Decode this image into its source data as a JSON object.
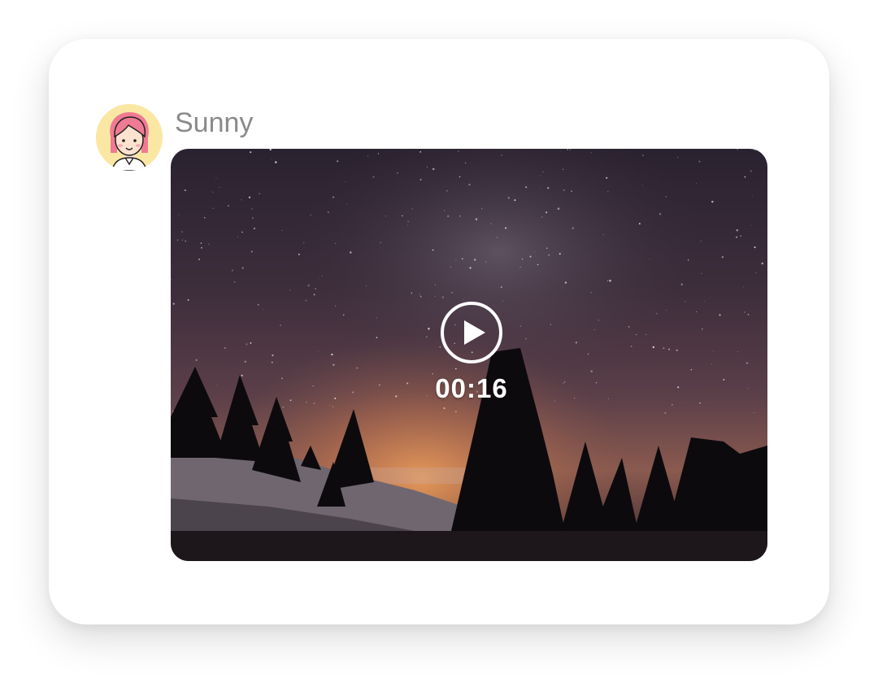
{
  "message": {
    "sender": {
      "name": "Sunny",
      "avatar_icon": "girl-avatar-icon"
    },
    "video": {
      "duration": "00:16",
      "play_icon": "play-icon"
    }
  },
  "colors": {
    "card_background": "#ffffff",
    "avatar_background": "#fbe7a4",
    "sender_name": "#8a8a8a",
    "overlay_text": "#ffffff"
  }
}
